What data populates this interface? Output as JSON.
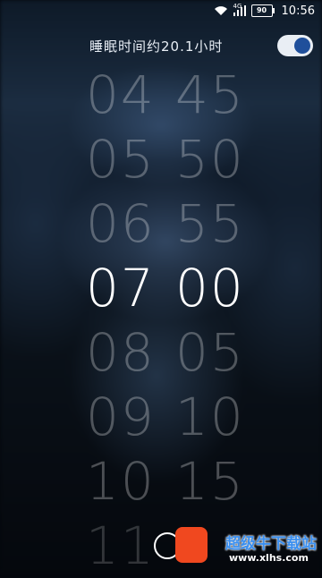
{
  "status_bar": {
    "network": "4G",
    "battery": "90",
    "time": "10:56"
  },
  "header": {
    "sleep_text": "睡眠时间约20.1小时",
    "alarm_enabled": true
  },
  "picker": {
    "rows": [
      {
        "hour": "04",
        "minute": "45"
      },
      {
        "hour": "05",
        "minute": "50"
      },
      {
        "hour": "06",
        "minute": "55"
      },
      {
        "hour": "07",
        "minute": "00"
      },
      {
        "hour": "08",
        "minute": "05"
      },
      {
        "hour": "09",
        "minute": "10"
      },
      {
        "hour": "10",
        "minute": "15"
      },
      {
        "hour": "11",
        "minute": ""
      }
    ],
    "selected_hour": "07",
    "selected_minute": "00"
  },
  "watermark": {
    "title": "超级牛下载站",
    "subtitle": "www.xlhs.com"
  },
  "colors": {
    "toggle_knob": "#1f4f9b",
    "toggle_track": "#e9eef4",
    "watermark_orange": "#f0481f",
    "watermark_blue": "#3a8ff0"
  }
}
